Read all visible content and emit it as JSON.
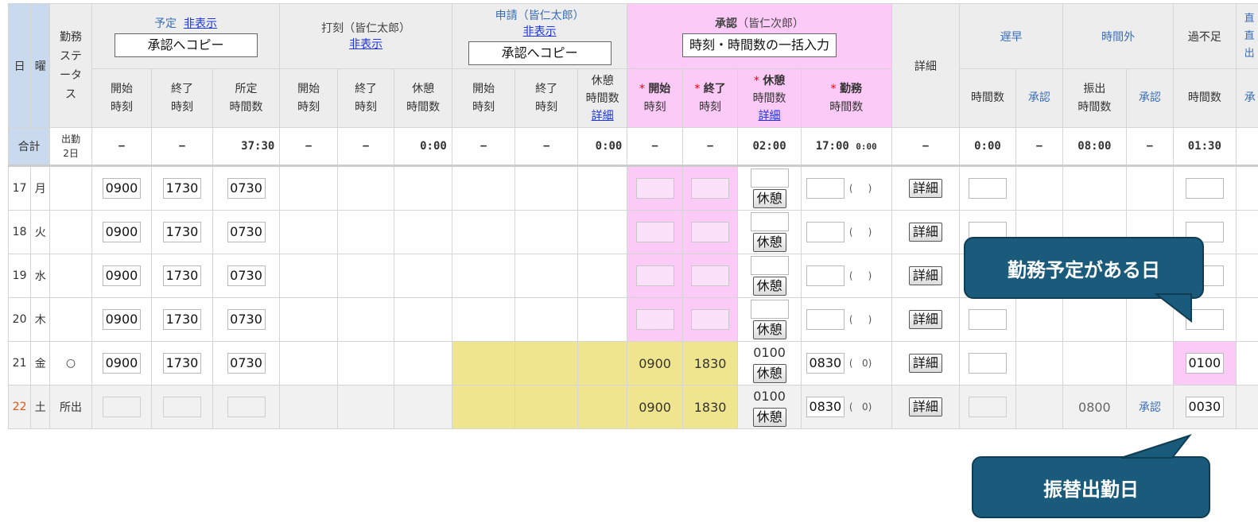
{
  "header": {
    "day": "日",
    "weekday": "曜",
    "status": "勤務ステータス",
    "yotei": {
      "label": "予定",
      "hide": "非表示",
      "copy": "承認へコピー"
    },
    "dakoku": {
      "label": "打刻（皆仁太郎）",
      "hide": "非表示"
    },
    "shinsei": {
      "label": "申請（皆仁太郎）",
      "hide": "非表示",
      "copy": "承認へコピー"
    },
    "shonin": {
      "label": "承認",
      "label_sub": "（皆仁次郎）",
      "bulk": "時刻・時間数の一括入力"
    },
    "detail": "詳細",
    "chisou": "遅早",
    "jikangai": "時間外",
    "kafusoku": "過不足",
    "cut": "直\n直\n出"
  },
  "subheader": {
    "start": [
      "開始",
      "時刻"
    ],
    "end": [
      "終了",
      "時刻"
    ],
    "shotei": [
      "所定",
      "時間数"
    ],
    "rest": [
      "休憩",
      "時間数"
    ],
    "rest_detail": "詳細",
    "s_start": "開始",
    "s_end": "終了",
    "s_rest": "休憩",
    "s_work": "勤務",
    "time": "時刻",
    "hours": "時間数",
    "approve": "承認",
    "furide": [
      "振出",
      "時間数"
    ],
    "cut": "承"
  },
  "totals": {
    "label": "合計",
    "days_label": "出勤",
    "days": "2日",
    "yotei": [
      "−",
      "−",
      "37:30"
    ],
    "dakoku": [
      "−",
      "−",
      "0:00"
    ],
    "shinsei": [
      "−",
      "−",
      "0:00"
    ],
    "shonin": [
      "−",
      "−",
      "02:00",
      "17:00",
      "0:00"
    ],
    "detail": "−",
    "chisou": [
      "0:00",
      "−"
    ],
    "jikangai": [
      "08:00",
      "−"
    ],
    "kafusoku": "01:30"
  },
  "rows": [
    {
      "d": "17",
      "w": "月",
      "status": "",
      "ys": "0900",
      "ye": "1730",
      "yh": "0730",
      "rest": "",
      "work": "",
      "paren": "",
      "kf": ""
    },
    {
      "d": "18",
      "w": "火",
      "status": "",
      "ys": "0900",
      "ye": "1730",
      "yh": "0730",
      "rest": "",
      "work": "",
      "paren": "",
      "kf": ""
    },
    {
      "d": "19",
      "w": "水",
      "status": "",
      "ys": "0900",
      "ye": "1730",
      "yh": "0730",
      "rest": "",
      "work": "",
      "paren": "",
      "kf": ""
    },
    {
      "d": "20",
      "w": "木",
      "status": "",
      "ys": "0900",
      "ye": "1730",
      "yh": "0730",
      "rest": "",
      "work": "",
      "paren": "",
      "kf": ""
    },
    {
      "d": "21",
      "w": "金",
      "status": "○",
      "ys": "0900",
      "ye": "1730",
      "yh": "0730",
      "ss": "0900",
      "se": "1830",
      "rest": "0100",
      "work": "0830",
      "paren": "0",
      "kf": "0100"
    },
    {
      "d": "22",
      "w": "土",
      "status": "所出",
      "ys": "",
      "ye": "",
      "yh": "",
      "ss": "0900",
      "se": "1830",
      "rest": "0100",
      "work": "0830",
      "paren": "0",
      "furide": "0800",
      "approve": "承認",
      "kf": "0030"
    }
  ],
  "buttons": {
    "rest": "休憩",
    "detail": "詳細"
  },
  "callouts": {
    "top": "勤務予定がある日",
    "bottom": "振替出勤日"
  },
  "colors": {
    "accent_blue": "#c9d9ee",
    "pink": "#fccaf7",
    "yellow": "#efe58e",
    "callout": "#1a5a7a"
  }
}
